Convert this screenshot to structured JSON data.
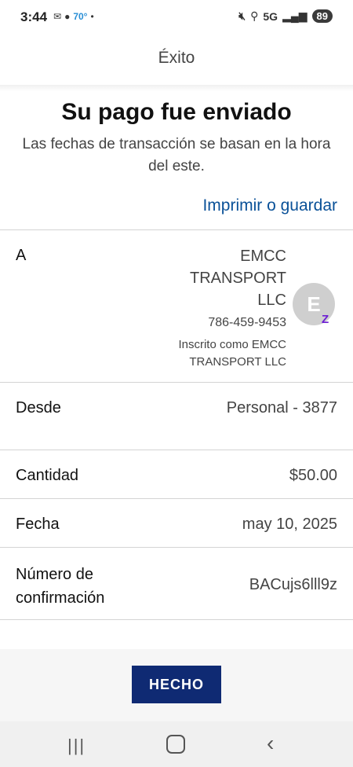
{
  "status_bar": {
    "time": "3:44",
    "temperature": "70°",
    "network": "5G",
    "battery": "89"
  },
  "header": {
    "title": "Éxito"
  },
  "confirmation": {
    "title": "Su pago fue enviado",
    "subtitle": "Las fechas de transacción se basan en la hora del este.",
    "print_link": "Imprimir o guardar"
  },
  "recipient": {
    "label": "A",
    "name": "EMCC TRANSPORT LLC",
    "phone": "786-459-9453",
    "enrolled": "Inscrito como EMCC TRANSPORT LLC",
    "avatar_letter": "E",
    "badge": "Z"
  },
  "details": {
    "from_label": "Desde",
    "from_value": "Personal - 3877",
    "amount_label": "Cantidad",
    "amount_value": "$50.00",
    "date_label": "Fecha",
    "date_value": "may 10, 2025",
    "confirmation_label": "Número de confirmación",
    "confirmation_value": "BACujs6lll9z"
  },
  "actions": {
    "done_label": "HECHO"
  },
  "colors": {
    "accent": "#0a5198",
    "button": "#0f2a73",
    "zelle": "#6d1ed4"
  }
}
